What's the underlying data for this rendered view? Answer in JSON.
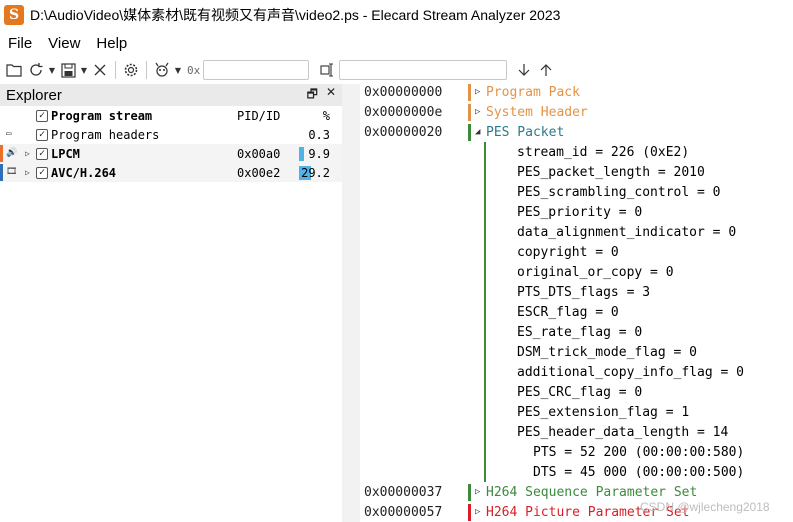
{
  "window": {
    "title": "D:\\AudioVideo\\媒体素材\\既有视频又有声音\\video2.ps - Elecard Stream Analyzer 2023",
    "icon": "app-logo-icon",
    "icon_letter": "S"
  },
  "menu": [
    "File",
    "View",
    "Help"
  ],
  "toolbar": {
    "hex_prefix": "0x",
    "offset_value": "",
    "search_value": ""
  },
  "explorer": {
    "title": "Explorer",
    "columns": {
      "pid": "PID/ID",
      "pct": "%"
    },
    "rows": [
      {
        "name": "Program stream",
        "pid": "",
        "pct": "",
        "bold": true,
        "checked": true
      },
      {
        "name": "Program headers",
        "pid": "",
        "pct": "0.3",
        "bold": false,
        "checked": true
      },
      {
        "name": "LPCM",
        "pid": "0x00a0",
        "pct": "9.9",
        "bold": true,
        "checked": true,
        "marker": "#e8702a",
        "pct_fraction": 0.099
      },
      {
        "name": "AVC/H.264",
        "pid": "0x00e2",
        "pct": "29.2",
        "bold": true,
        "checked": true,
        "marker": "#2f6fb5",
        "pct_fraction": 0.292
      }
    ]
  },
  "detail": {
    "colors": {
      "orange": "#e39347",
      "green": "#3c8a3c",
      "red": "#d81f26",
      "blue_text": "#2a7a8a"
    },
    "top_items": [
      {
        "addr": "0x00000000",
        "label": "Program Pack",
        "color": "orange",
        "expanded": false
      },
      {
        "addr": "0x0000000e",
        "label": "System Header",
        "color": "orange",
        "expanded": false
      },
      {
        "addr": "0x00000020",
        "label": "PES Packet",
        "color": "green",
        "expanded": true
      }
    ],
    "fields": [
      "stream_id = 226 (0xE2)",
      "PES_packet_length = 2010",
      "PES_scrambling_control = 0",
      "PES_priority = 0",
      "data_alignment_indicator = 0",
      "copyright = 0",
      "original_or_copy = 0",
      "PTS_DTS_flags = 3",
      "ESCR_flag = 0",
      "ES_rate_flag = 0",
      "DSM_trick_mode_flag = 0",
      "additional_copy_info_flag = 0",
      "PES_CRC_flag = 0",
      "PES_extension_flag = 1",
      "PES_header_data_length = 14"
    ],
    "sub_fields": [
      "PTS = 52 200 (00:00:00:580)",
      "DTS = 45 000 (00:00:00:500)"
    ],
    "bottom_items": [
      {
        "addr": "0x00000037",
        "label": "H264 Sequence Parameter Set",
        "color": "green"
      },
      {
        "addr": "0x00000057",
        "label": "H264 Picture Parameter Set",
        "color": "red"
      }
    ]
  },
  "watermark": "CSDN @wjlecheng2018"
}
